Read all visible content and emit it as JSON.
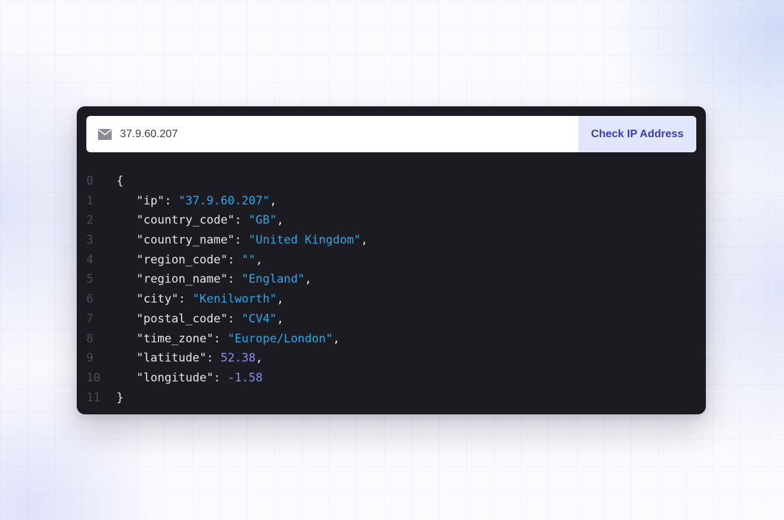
{
  "search": {
    "value": "37.9.60.207",
    "button_label": "Check IP Address",
    "icon": "mail-icon"
  },
  "code": {
    "line_numbers": [
      "0",
      "1",
      "2",
      "3",
      "4",
      "5",
      "6",
      "7",
      "8",
      "9",
      "10",
      "11"
    ],
    "open_brace": "{",
    "close_brace": "}",
    "fields": [
      {
        "key": "\"ip\"",
        "value": "\"37.9.60.207\"",
        "trail": ","
      },
      {
        "key": "\"country_code\"",
        "value": "\"GB\"",
        "trail": ","
      },
      {
        "key": "\"country_name\"",
        "value": "\"United Kingdom\"",
        "trail": ","
      },
      {
        "key": "\"region_code\"",
        "value": "\"\"",
        "trail": ","
      },
      {
        "key": "\"region_name\"",
        "value": "\"England\"",
        "trail": ","
      },
      {
        "key": "\"city\"",
        "value": "\"Kenilworth\"",
        "trail": ","
      },
      {
        "key": "\"postal_code\"",
        "value": "\"CV4\"",
        "trail": ","
      },
      {
        "key": "\"time_zone\"",
        "value": "\"Europe/London\"",
        "trail": ","
      },
      {
        "key": "\"latitude\"",
        "value": "52.38",
        "trail": ","
      },
      {
        "key": "\"longitude\"",
        "value": "-1.58",
        "trail": ""
      }
    ],
    "colors": {
      "string": "#2ea6e6",
      "number": "#8b8ff0",
      "line_number": "#4c4c56",
      "background": "#1b1b21"
    }
  }
}
